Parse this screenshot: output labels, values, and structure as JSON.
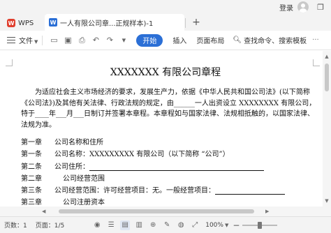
{
  "window": {
    "login_label": "登录",
    "app_name": "WPS",
    "doc_tab_title": "一人有限公司章...正规样本)-1",
    "new_tab": "+"
  },
  "menu": {
    "file_label": "文件",
    "start_label": "开始",
    "insert_label": "插入",
    "layout_label": "页面布局",
    "search_label": "查找命令、搜索模板",
    "more_label": "···"
  },
  "document": {
    "title": "XXXXXXX 有限公司章程",
    "intro": "为适应社会主义市场经济的要求，发展生产力，依据《中华人民共和国公司法》(以下简称《公司法》)及其他有关法律、行政法规的规定，由______一人出资设立 XXXXXXXX 有限公司，特于____年___月___日制订并签署本章程。本章程如与国家法律、法规相抵触的，以国家法律、法规为准。",
    "lines": [
      {
        "chapter": "第一章",
        "text": "公司名称和住所"
      },
      {
        "chapter": "第一条",
        "text": "公司名称：XXXXXXXXX 有限公司（以下简称 “公司”）"
      },
      {
        "chapter": "第二条",
        "text": "公司住所："
      },
      {
        "chapter": "第二章",
        "text": "公司经营范围"
      },
      {
        "chapter": "第三条",
        "text": "公司经营范围：许可经营项目：无。一般经营项目："
      },
      {
        "chapter": "第三章",
        "text": "公司注册资本"
      }
    ]
  },
  "status": {
    "page": "页数：1",
    "page_of": "页面：1/5",
    "zoom": "100%",
    "zoom_minus": "−"
  },
  "colors": {
    "accent": "#2b6fd6",
    "close": "#e81123"
  }
}
